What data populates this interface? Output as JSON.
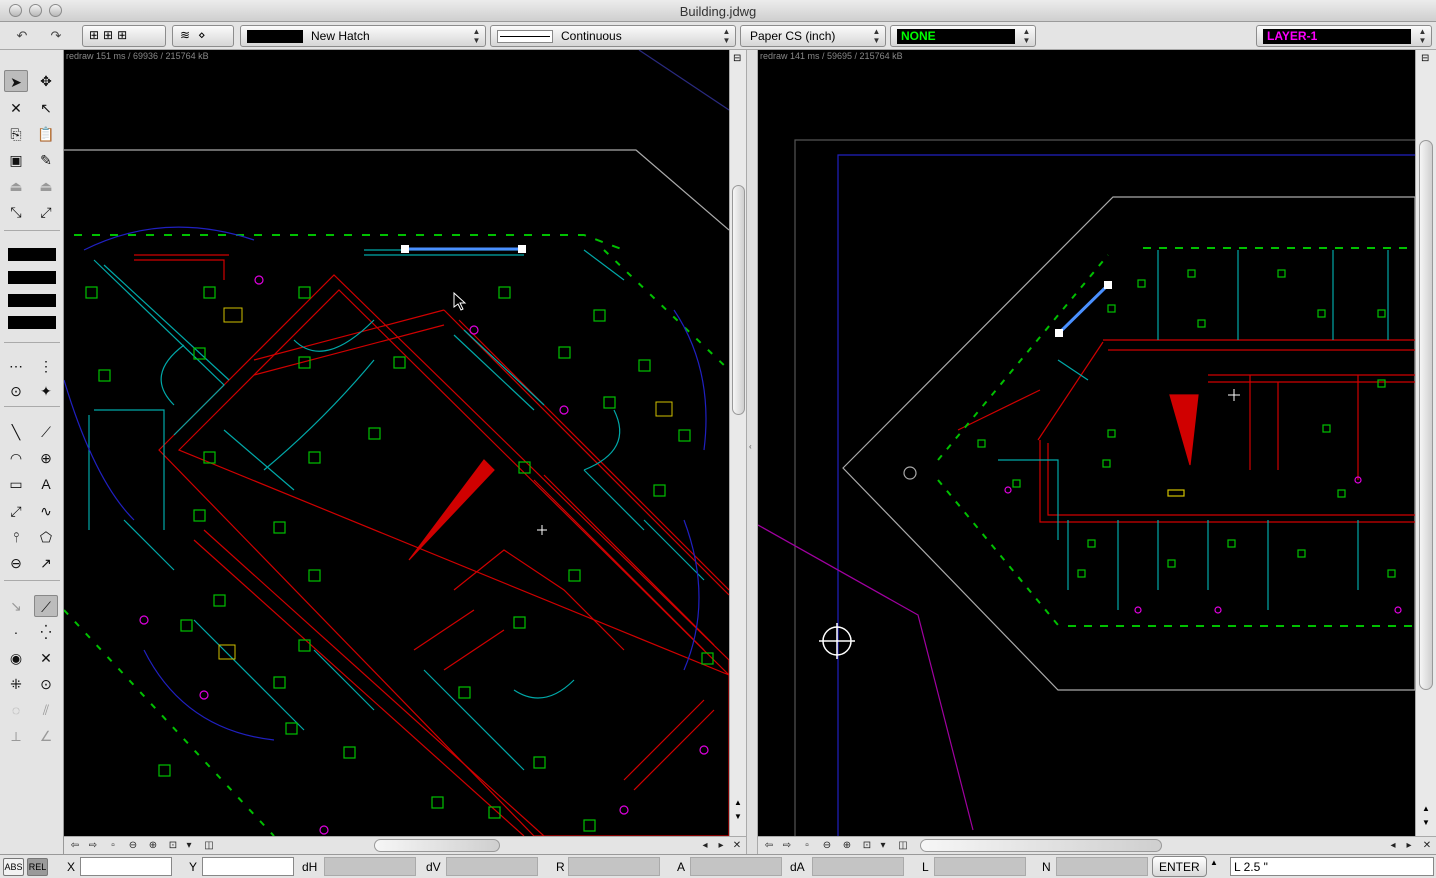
{
  "window": {
    "title": "Building.jdwg"
  },
  "toolbar": {
    "hatch": "New Hatch",
    "linetype": "Continuous",
    "units": "Paper CS (inch)",
    "color": "NONE",
    "layer": "LAYER-1"
  },
  "viewports": {
    "left": {
      "redraw": "redraw 151 ms / 69936 / 215764 kB"
    },
    "right": {
      "redraw": "redraw 141 ms / 59695 / 215764 kB"
    }
  },
  "status": {
    "abs": "ABS",
    "rel": "REL",
    "x_label": "X",
    "y_label": "Y",
    "dh_label": "dH",
    "dv_label": "dV",
    "r_label": "R",
    "a_label": "A",
    "da_label": "dA",
    "l_label": "L",
    "n_label": "N",
    "enter": "ENTER",
    "command": "L 2.5 \""
  },
  "colors": {
    "cad_green": "#00c000",
    "cad_red": "#d00000",
    "cad_cyan": "#00a8a8",
    "cad_magenta": "#e000e0",
    "cad_blue": "#2020c0",
    "layer_magenta": "#ff00ff"
  }
}
